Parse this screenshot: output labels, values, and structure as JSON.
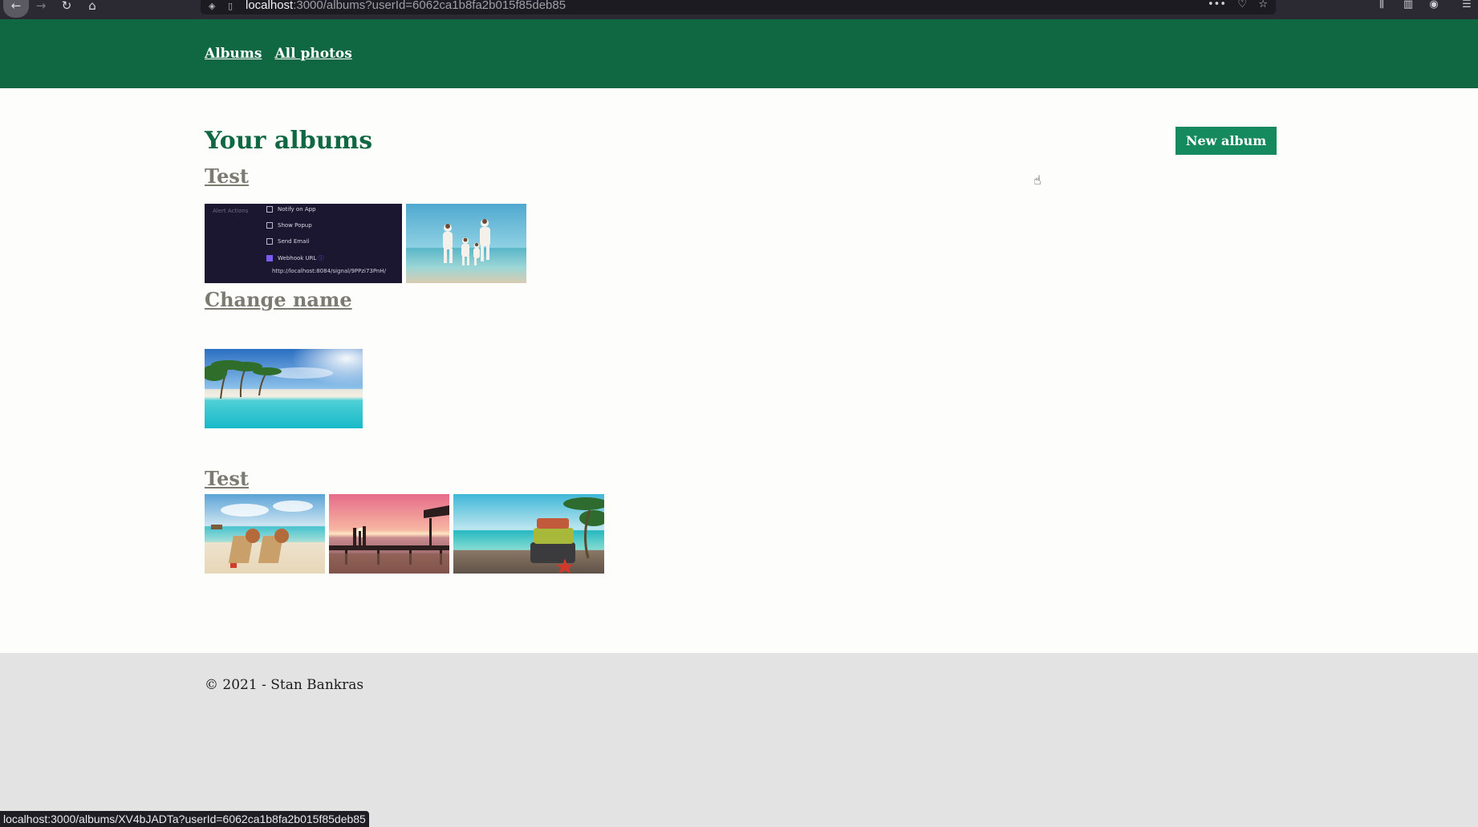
{
  "browser": {
    "url_host": "localhost",
    "url_rest": ":3000/albums?userId=6062ca1b8fa2b015f85deb85",
    "icons": [
      "back-icon",
      "forward-icon",
      "reload-icon",
      "home-icon",
      "shield-icon",
      "page-icon",
      "more-icon",
      "pocket-icon",
      "star-icon",
      "library-icon",
      "sidebar-icon",
      "account-icon",
      "menu-icon"
    ],
    "status_url": "localhost:3000/albums/XV4bJADTa?userId=6062ca1b8fa2b015f85deb85"
  },
  "header": {
    "nav": [
      "Albums",
      "All photos"
    ],
    "bg_color": "#106842"
  },
  "main": {
    "title": "Your albums",
    "new_album_label": "New album",
    "accent_color": "#168a5f",
    "albums": [
      {
        "title": "Test",
        "photos": [
          {
            "kind": "screenshot",
            "section_label": "Alert Actions",
            "options": [
              {
                "label": "Notify on App",
                "checked": false
              },
              {
                "label": "Show Popup",
                "checked": false
              },
              {
                "label": "Send Email",
                "checked": false
              },
              {
                "label": "Webhook URL",
                "checked": true
              }
            ],
            "webhook": "http://localhost:8084/signal/9PPzi73PnH/"
          },
          {
            "kind": "family-beach"
          }
        ]
      },
      {
        "title": "Change name",
        "photos": [
          {
            "kind": "palm-beach"
          }
        ]
      },
      {
        "title": "Test",
        "photos": [
          {
            "kind": "beach-chairs"
          },
          {
            "kind": "sunset-pier"
          },
          {
            "kind": "suitcase-beach"
          }
        ]
      }
    ]
  },
  "footer": {
    "text": "© 2021 - Stan Bankras"
  }
}
